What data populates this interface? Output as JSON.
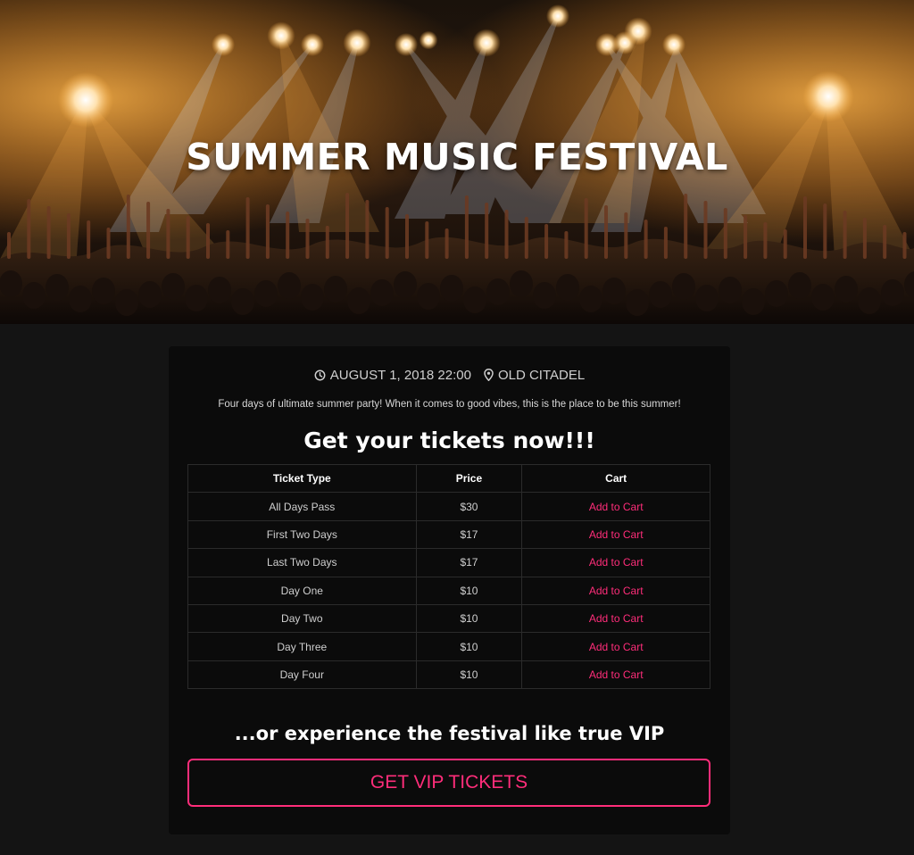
{
  "hero": {
    "title": "SUMMER MUSIC FESTIVAL"
  },
  "event": {
    "datetime": "AUGUST 1, 2018 22:00",
    "venue": "OLD CITADEL",
    "datetime_icon": "clock-icon",
    "venue_icon": "map-marker-icon",
    "description": "Four days of ultimate summer party! When it comes to good vibes, this is the place to be this summer!"
  },
  "tickets": {
    "headline": "Get your tickets now!!!",
    "columns": [
      "Ticket Type",
      "Price",
      "Cart"
    ],
    "rows": [
      {
        "type": "All Days Pass",
        "price": "$30",
        "cart": "Add to Cart"
      },
      {
        "type": "First Two Days",
        "price": "$17",
        "cart": "Add to Cart"
      },
      {
        "type": "Last Two Days",
        "price": "$17",
        "cart": "Add to Cart"
      },
      {
        "type": "Day One",
        "price": "$10",
        "cart": "Add to Cart"
      },
      {
        "type": "Day Two",
        "price": "$10",
        "cart": "Add to Cart"
      },
      {
        "type": "Day Three",
        "price": "$10",
        "cart": "Add to Cart"
      },
      {
        "type": "Day Four",
        "price": "$10",
        "cart": "Add to Cart"
      }
    ]
  },
  "vip": {
    "text": "...or experience the festival like true VIP",
    "button_label": "GET VIP TICKETS"
  },
  "colors": {
    "accent": "#ff2d7a",
    "background": "#141414",
    "card": "#0b0b0b"
  }
}
